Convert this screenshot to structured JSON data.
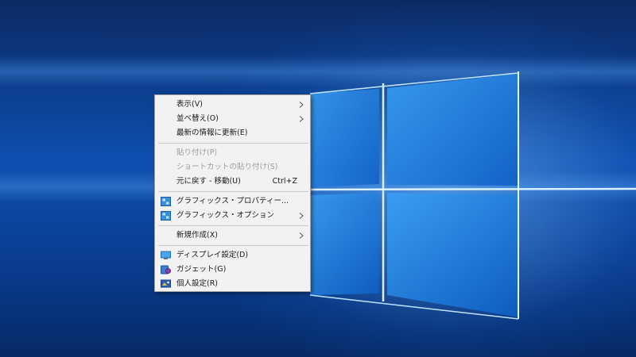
{
  "menu": {
    "view": "表示(V)",
    "sort": "並べ替え(O)",
    "refresh": "最新の情報に更新(E)",
    "paste": "貼り付け(P)",
    "paste_shortcut": "ショートカットの貼り付け(S)",
    "undo": "元に戻す - 移動(U)",
    "undo_key": "Ctrl+Z",
    "graphics_properties": "グラフィックス・プロパティー...",
    "graphics_options": "グラフィックス・オプション",
    "new": "新規作成(X)",
    "display_settings": "ディスプレイ設定(D)",
    "gadgets": "ガジェット(G)",
    "personalize": "個人設定(R)"
  },
  "colors": {
    "desktop_blue": "#0d4fb0",
    "menu_background": "#f2f2f2",
    "disabled_text": "#9b9b9b"
  },
  "icons": [
    "intel-graphics-icon",
    "monitor-icon",
    "gadget-icon",
    "personalize-icon",
    "chevron-right-icon"
  ]
}
